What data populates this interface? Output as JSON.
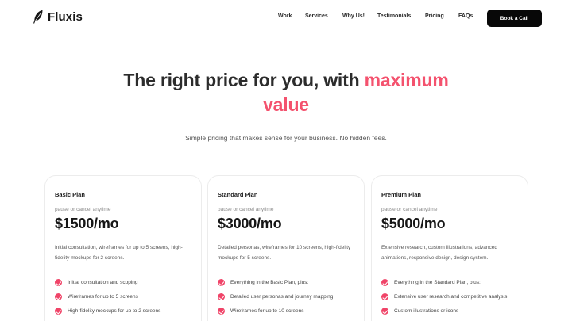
{
  "brand": {
    "name": "Fluxis",
    "logo_icon": "feather-icon"
  },
  "nav": {
    "links": [
      "Work",
      "Services",
      "Why Us!",
      "Testimonials",
      "Pricing",
      "FAQs"
    ],
    "cta_label": "Book a Call"
  },
  "hero": {
    "title_prefix": "The right price for you, with",
    "title_accent_1": "maximum",
    "title_accent_2": "value",
    "subtitle": "Simple pricing that makes sense for your business. No hidden fees.",
    "accent_color": "#f4526e"
  },
  "plans": [
    {
      "name": "Basic Plan",
      "note": "pause or cancel anytime",
      "price": "$1500/mo",
      "description": "Initial consultation, wireframes for up to 5 screens, high-fidelity mockups for 2 screens.",
      "features": [
        "Initial consultation and scoping",
        "Wireframes for up to 5 screens",
        "High-fidelity mockups for up to 2 screens"
      ]
    },
    {
      "name": "Standard Plan",
      "note": "pause or cancel anytime",
      "price": "$3000/mo",
      "description": "Detailed personas, wireframes for 10 screens, high-fidelity mockups for 5 screens.",
      "features": [
        "Everything in the Basic Plan, plus:",
        "Detailed user personas and journey mapping",
        "Wireframes for up to 10 screens"
      ]
    },
    {
      "name": "Premium Plan",
      "note": "pause or cancel anytime",
      "price": "$5000/mo",
      "description": "Extensive research, custom illustrations, advanced animations, responsive design, design system.",
      "features": [
        "Everything in the Standard Plan, plus:",
        "Extensive user research and competitive analysis",
        "Custom illustrations or icons"
      ]
    }
  ]
}
